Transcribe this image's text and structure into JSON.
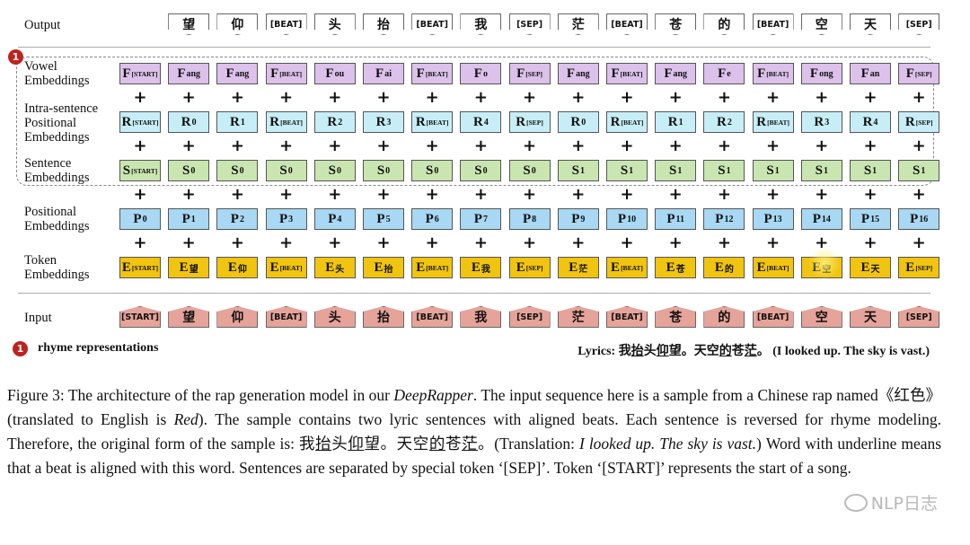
{
  "labels": {
    "output": "Output",
    "vowel": [
      "Vowel",
      "Embeddings"
    ],
    "intra": [
      "Intra-sentence",
      "Positional",
      "Embeddings"
    ],
    "sentence": [
      "Sentence",
      "Embeddings"
    ],
    "positional": [
      "Positional",
      "Embeddings"
    ],
    "token": [
      "Token",
      "Embeddings"
    ],
    "input": "Input"
  },
  "badge": "1",
  "output_tokens": [
    "望",
    "仰",
    "[BEAT]",
    "头",
    "抬",
    "[BEAT]",
    "我",
    "[SEP]",
    "茫",
    "[BEAT]",
    "苍",
    "的",
    "[BEAT]",
    "空",
    "天",
    "[SEP]"
  ],
  "input_tokens": [
    "[START]",
    "望",
    "仰",
    "[BEAT]",
    "头",
    "抬",
    "[BEAT]",
    "我",
    "[SEP]",
    "茫",
    "[BEAT]",
    "苍",
    "的",
    "[BEAT]",
    "空",
    "天",
    "[SEP]"
  ],
  "vowel_row": {
    "base": "F",
    "subs": [
      "[START]",
      "ang",
      "ang",
      "[BEAT]",
      "ou",
      "ai",
      "[BEAT]",
      "o",
      "[SEP]",
      "ang",
      "[BEAT]",
      "ang",
      "e",
      "[BEAT]",
      "ong",
      "an",
      "[SEP]"
    ]
  },
  "intra_row": {
    "base": "R",
    "subs": [
      "[START]",
      "0",
      "1",
      "[BEAT]",
      "2",
      "3",
      "[BEAT]",
      "4",
      "[SEP]",
      "0",
      "[BEAT]",
      "1",
      "2",
      "[BEAT]",
      "3",
      "4",
      "[SEP]"
    ]
  },
  "sent_row": {
    "base": "S",
    "subs": [
      "[START]",
      "0",
      "0",
      "0",
      "0",
      "0",
      "0",
      "0",
      "0",
      "1",
      "1",
      "1",
      "1",
      "1",
      "1",
      "1",
      "1"
    ]
  },
  "pos_row": {
    "base": "P",
    "subs": [
      "0",
      "1",
      "2",
      "3",
      "4",
      "5",
      "6",
      "7",
      "8",
      "9",
      "10",
      "11",
      "12",
      "13",
      "14",
      "15",
      "16"
    ]
  },
  "tok_row": {
    "base": "E",
    "subs": [
      "[START]",
      "望",
      "仰",
      "[BEAT]",
      "头",
      "抬",
      "[BEAT]",
      "我",
      "[SEP]",
      "茫",
      "[BEAT]",
      "苍",
      "的",
      "[BEAT]",
      "空",
      "天",
      "[SEP]"
    ]
  },
  "plus": "+",
  "legend": "rhyme representations",
  "lyrics": {
    "prefix": "Lyrics: ",
    "c1": "我",
    "c2": "抬",
    "c3": "头",
    "c4": "仰",
    "c5": "望。天空",
    "c6": "的",
    "c7": "苍",
    "c8": "茫",
    "c9": "。",
    "translation": "(I looked up. The sky is vast.)"
  },
  "caption": {
    "p1": "Figure 3: The architecture of the rap generation model in our ",
    "model": "DeepRapper",
    "p2": ". The input sequence here is a sample from a Chinese rap named《红色》(translated to English is ",
    "red": "Red",
    "p3": "). The sample contains two lyric sentences with aligned beats. Each sentence is reversed for rhyme modeling. Therefore, the original form of the sample is: ",
    "z1": "我",
    "z2": "抬",
    "z3": "头",
    "z4": "仰",
    "z5": "望。天空",
    "z6": "的",
    "z7": "苍",
    "z8": "茫",
    "p4": "。(Translation: ",
    "translation": "I looked up. The sky is vast.",
    "p5": ") Word with underline means that a beat is aligned with this word. Sentences are separated by special token ‘[SEP]’. Token ‘[START]’ represents the start of a song."
  },
  "watermark": "NLP日志"
}
